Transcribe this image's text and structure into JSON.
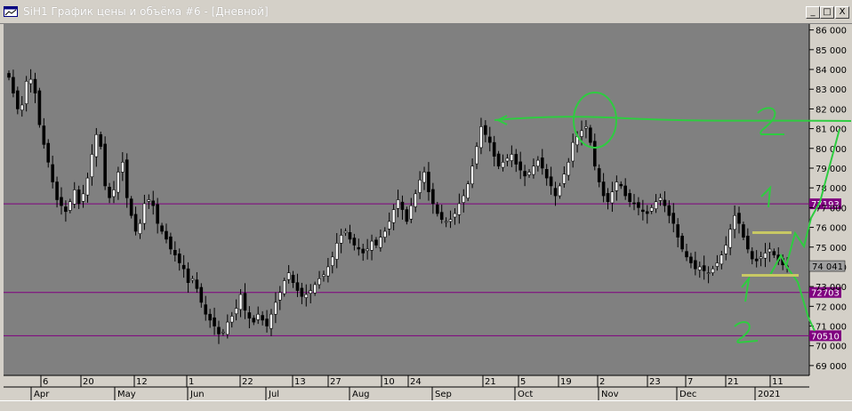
{
  "window": {
    "title": "SiH1 График цены и объёма #6 - [Дневной]",
    "buttons": [
      "_",
      "□",
      "X"
    ]
  },
  "colors": {
    "plot_bg": "#808080",
    "level_line": "#800080",
    "level_tag": "#800080",
    "last_price_tag_bg": "#808080",
    "annotation": "#2ecc40",
    "range_box": "#c8c864"
  },
  "chart_data": {
    "type": "candlestick",
    "title": "",
    "ylim": [
      68500,
      86300
    ],
    "y_ticks": [
      "86 000",
      "85 000",
      "84 000",
      "83 000",
      "82 000",
      "81 000",
      "80 000",
      "79 000",
      "78 000",
      "77 000",
      "76 000",
      "75 000",
      "74 000",
      "73 000",
      "72 000",
      "71 000",
      "70 000",
      "69 000"
    ],
    "y_tick_values": [
      86000,
      85000,
      84000,
      83000,
      82000,
      81000,
      80000,
      79000,
      78000,
      77000,
      76000,
      75000,
      74000,
      73000,
      72000,
      71000,
      70000,
      69000
    ],
    "x_day_labels": [
      "6",
      "20",
      "12",
      "1",
      "22",
      "13",
      "27",
      "10",
      "24",
      "21",
      "5",
      "19",
      "2",
      "23",
      "7",
      "21",
      "11"
    ],
    "x_month_labels": [
      "Apr",
      "May",
      "Jun",
      "Jul",
      "Aug",
      "Sep",
      "Oct",
      "Nov",
      "Dec",
      "2021"
    ],
    "level_lines": [
      {
        "value": 77193,
        "label": "77193"
      },
      {
        "value": 72703,
        "label": "72703"
      },
      {
        "value": 70510,
        "label": "70510"
      }
    ],
    "last_price": {
      "value": 74041,
      "label": "74 041"
    },
    "series_close": [
      83600,
      82800,
      82000,
      82200,
      83400,
      83500,
      82800,
      81200,
      80200,
      79300,
      78300,
      77400,
      77100,
      76800,
      77300,
      77900,
      77200,
      77700,
      78500,
      79700,
      80700,
      80100,
      78100,
      77500,
      77900,
      78800,
      79300,
      77500,
      76600,
      75800,
      76200,
      77200,
      77400,
      77100,
      76200,
      75800,
      75400,
      74900,
      74600,
      74200,
      73900,
      73200,
      73400,
      72900,
      72200,
      71600,
      71300,
      71000,
      70600,
      70700,
      71200,
      71500,
      71900,
      72600,
      71800,
      71400,
      71200,
      71600,
      71300,
      71000,
      71600,
      72200,
      72700,
      73300,
      73700,
      73200,
      72800,
      72500,
      72600,
      72800,
      73100,
      73400,
      73600,
      74000,
      74500,
      75200,
      75600,
      75800,
      75400,
      75100,
      74900,
      74700,
      74900,
      75300,
      75100,
      75500,
      75800,
      76300,
      76900,
      77400,
      76900,
      76300,
      77100,
      77700,
      78400,
      78800,
      77800,
      77200,
      76700,
      76400,
      76300,
      76400,
      76700,
      77200,
      77600,
      78200,
      79100,
      80100,
      81100,
      80700,
      80300,
      79600,
      79100,
      79300,
      79500,
      79700,
      79200,
      78900,
      78600,
      78800,
      79100,
      79400,
      79000,
      78500,
      78100,
      77600,
      78100,
      78700,
      79300,
      80300,
      80600,
      80900,
      81100,
      80300,
      79100,
      78300,
      77600,
      77300,
      77800,
      78300,
      78100,
      77600,
      77300,
      77200,
      77000,
      76800,
      76700,
      77000,
      77300,
      77500,
      77100,
      76600,
      76200,
      75500,
      74900,
      74500,
      74200,
      73900,
      74000,
      73800,
      73700,
      73900,
      74200,
      74600,
      75100,
      75900,
      76600,
      76200,
      75500,
      74900,
      74400,
      74300,
      74500,
      74700,
      74900,
      74600,
      74300,
      74100,
      74041
    ]
  }
}
